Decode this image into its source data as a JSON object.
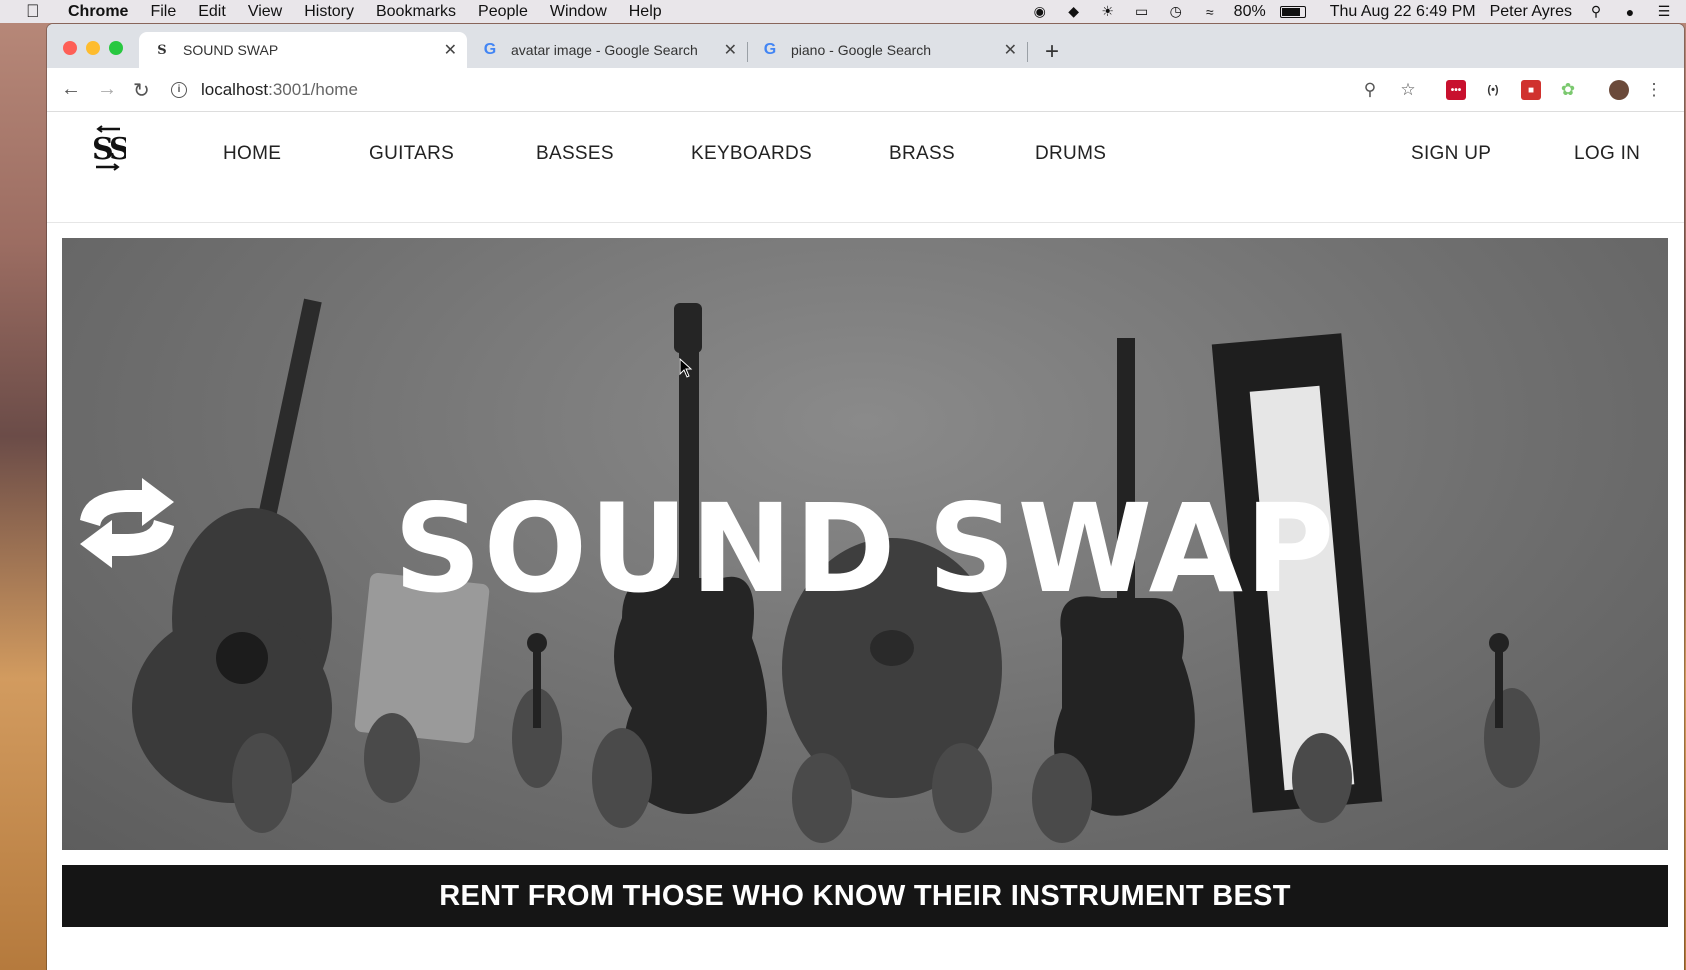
{
  "menubar": {
    "app": "Chrome",
    "items": [
      "File",
      "Edit",
      "View",
      "History",
      "Bookmarks",
      "People",
      "Window",
      "Help"
    ],
    "battery": "80%",
    "datetime": "Thu Aug 22  6:49 PM",
    "user": "Peter Ayres"
  },
  "tabs": [
    {
      "title": "SOUND SWAP",
      "favicon": "ss-logo-icon"
    },
    {
      "title": "avatar image - Google Search",
      "favicon": "google-icon"
    },
    {
      "title": "piano - Google Search",
      "favicon": "google-icon"
    }
  ],
  "address": {
    "host": "localhost",
    "path": ":3001/home"
  },
  "site": {
    "logo": "SS",
    "nav": [
      "HOME",
      "GUITARS",
      "BASSES",
      "KEYBOARDS",
      "BRASS",
      "DRUMS"
    ],
    "auth": {
      "signup": "SIGN UP",
      "login": "LOG IN"
    },
    "hero": {
      "left": "SOUND",
      "right": "SWAP"
    },
    "tagline": "RENT FROM THOSE WHO KNOW THEIR INSTRUMENT BEST"
  }
}
